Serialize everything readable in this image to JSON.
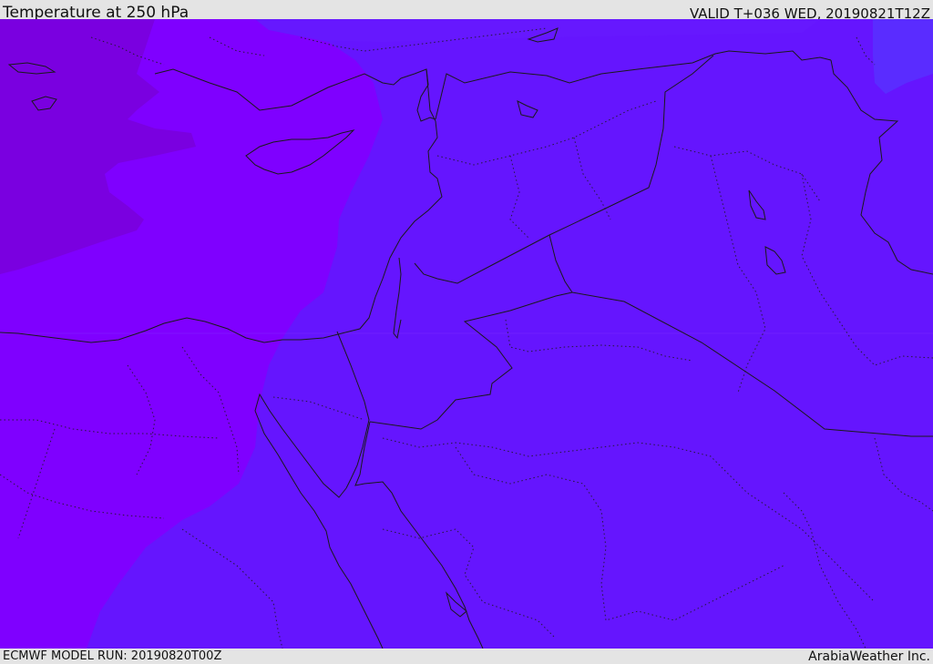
{
  "header": {
    "title": "Temperature at 250 hPa",
    "valid_time": "VALID T+036 WED, 20190821T12Z"
  },
  "footer": {
    "model_run": "ECMWF MODEL RUN: 20190820T00Z",
    "credit": "ArabiaWeather Inc."
  },
  "map": {
    "field": "temperature",
    "level_hpa": 250,
    "colors": {
      "coldest_zone": "#7a00e0",
      "cold_zone": "#7f00ff",
      "cool_zone": "#6515fe",
      "milder_zone": "#5a2cff",
      "border_line": "#1a1a1a"
    },
    "country_borders": "solid",
    "province_borders": "dotted"
  }
}
